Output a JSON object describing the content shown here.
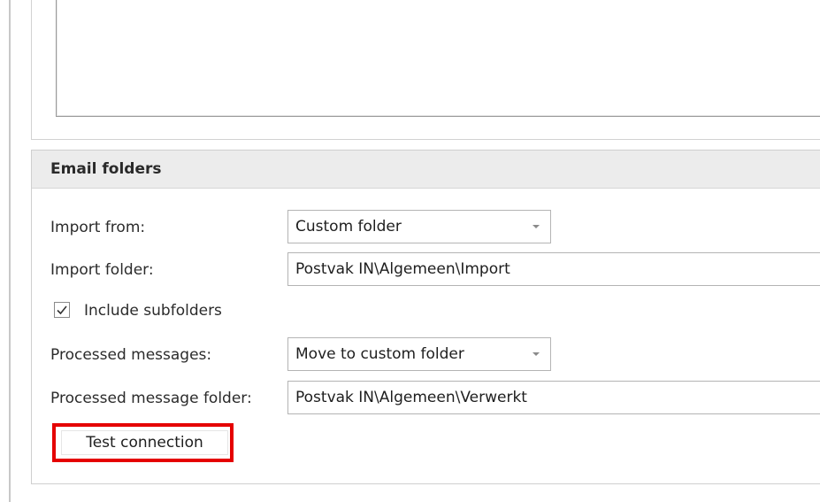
{
  "email_folders": {
    "title": "Email folders",
    "import_from": {
      "label": "Import from:",
      "value": "Custom folder"
    },
    "import_folder": {
      "label": "Import folder:",
      "value": "Postvak IN\\Algemeen\\Import"
    },
    "include_subfolders": {
      "label": "Include subfolders",
      "checked": true
    },
    "processed_messages": {
      "label": "Processed messages:",
      "value": "Move to custom folder"
    },
    "processed_message_folder": {
      "label": "Processed message folder:",
      "value": "Postvak IN\\Algemeen\\Verwerkt"
    },
    "test_connection": {
      "label": "Test connection"
    }
  },
  "colors": {
    "highlight": "#e50000",
    "header_bg": "#ececec"
  },
  "icons": {
    "dropdown": "chevron-down-icon",
    "check": "checkmark-icon"
  }
}
